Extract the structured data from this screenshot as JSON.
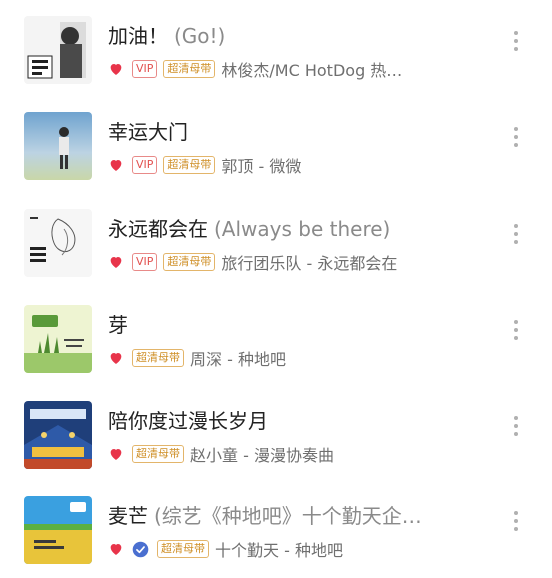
{
  "songs": [
    {
      "title": "加油！",
      "subtitle": "(Go!)",
      "liked": true,
      "vip": true,
      "hq": true,
      "check": false,
      "artist": "林俊杰/MC HotDog 热…",
      "cover_colors": [
        "#f4f4f4",
        "#222222"
      ]
    },
    {
      "title": "幸运大门",
      "subtitle": "",
      "liked": true,
      "vip": true,
      "hq": true,
      "check": false,
      "artist": "郭顶 - 微微",
      "cover_colors": [
        "#7fb2d8",
        "#c8d9b6"
      ]
    },
    {
      "title": "永远都会在",
      "subtitle": "(Always be there)",
      "liked": true,
      "vip": true,
      "hq": true,
      "check": false,
      "artist": "旅行团乐队 - 永远都会在",
      "cover_colors": [
        "#f6f6f6",
        "#2a2a2a"
      ]
    },
    {
      "title": "芽",
      "subtitle": "",
      "liked": true,
      "vip": false,
      "hq": true,
      "check": false,
      "artist": "周深 - 种地吧",
      "cover_colors": [
        "#e6f0c4",
        "#5a9a3a"
      ]
    },
    {
      "title": "陪你度过漫长岁月",
      "subtitle": "",
      "liked": true,
      "vip": false,
      "hq": true,
      "check": false,
      "artist": "赵小童 - 漫漫协奏曲",
      "cover_colors": [
        "#1f3f7a",
        "#f0c040"
      ]
    },
    {
      "title": "麦芒",
      "subtitle": "(综艺《种地吧》十个勤天企…",
      "liked": true,
      "vip": false,
      "hq": true,
      "check": true,
      "artist": "十个勤天 - 种地吧",
      "cover_colors": [
        "#3aa0e0",
        "#e8c43a"
      ]
    }
  ],
  "labels": {
    "vip": "VIP",
    "hq": "超清母带"
  },
  "colors": {
    "heart": "#e8344a",
    "check": "#4a6fd0"
  }
}
